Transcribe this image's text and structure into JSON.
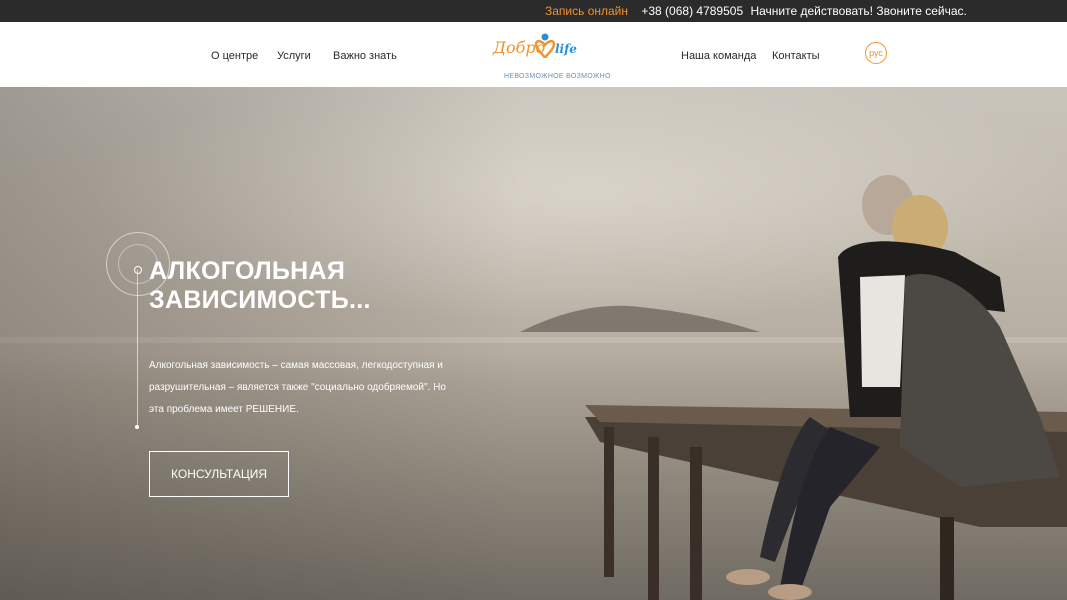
{
  "topbar": {
    "book_online": "Запись онлайн",
    "phone": "+38 (068) 4789505",
    "cta": "Начните действовать! Звоните сейчас."
  },
  "nav": {
    "left": [
      "О центре",
      "Услуги",
      "Важно знать"
    ],
    "right": [
      "Наша команда",
      "Контакты"
    ]
  },
  "logo": {
    "word1": "Добро",
    "word2": "life",
    "tagline": "НЕВОЗМОЖНОЕ ВОЗМОЖНО"
  },
  "lang": "рус",
  "hero": {
    "title_line1": "АЛКОГОЛЬНАЯ",
    "title_line2": "ЗАВИСИМОСТЬ...",
    "text": "Алкогольная зависимость – самая массовая, легкодоступная и разрушительная – является также \"социально одобряемой\". Но эта проблема имеет РЕШЕНИЕ.",
    "button": "КОНСУЛЬТАЦИЯ"
  },
  "colors": {
    "accent": "#f0932a",
    "brand_blue": "#2a8fd0",
    "topbar_bg": "#2b2b2b"
  }
}
